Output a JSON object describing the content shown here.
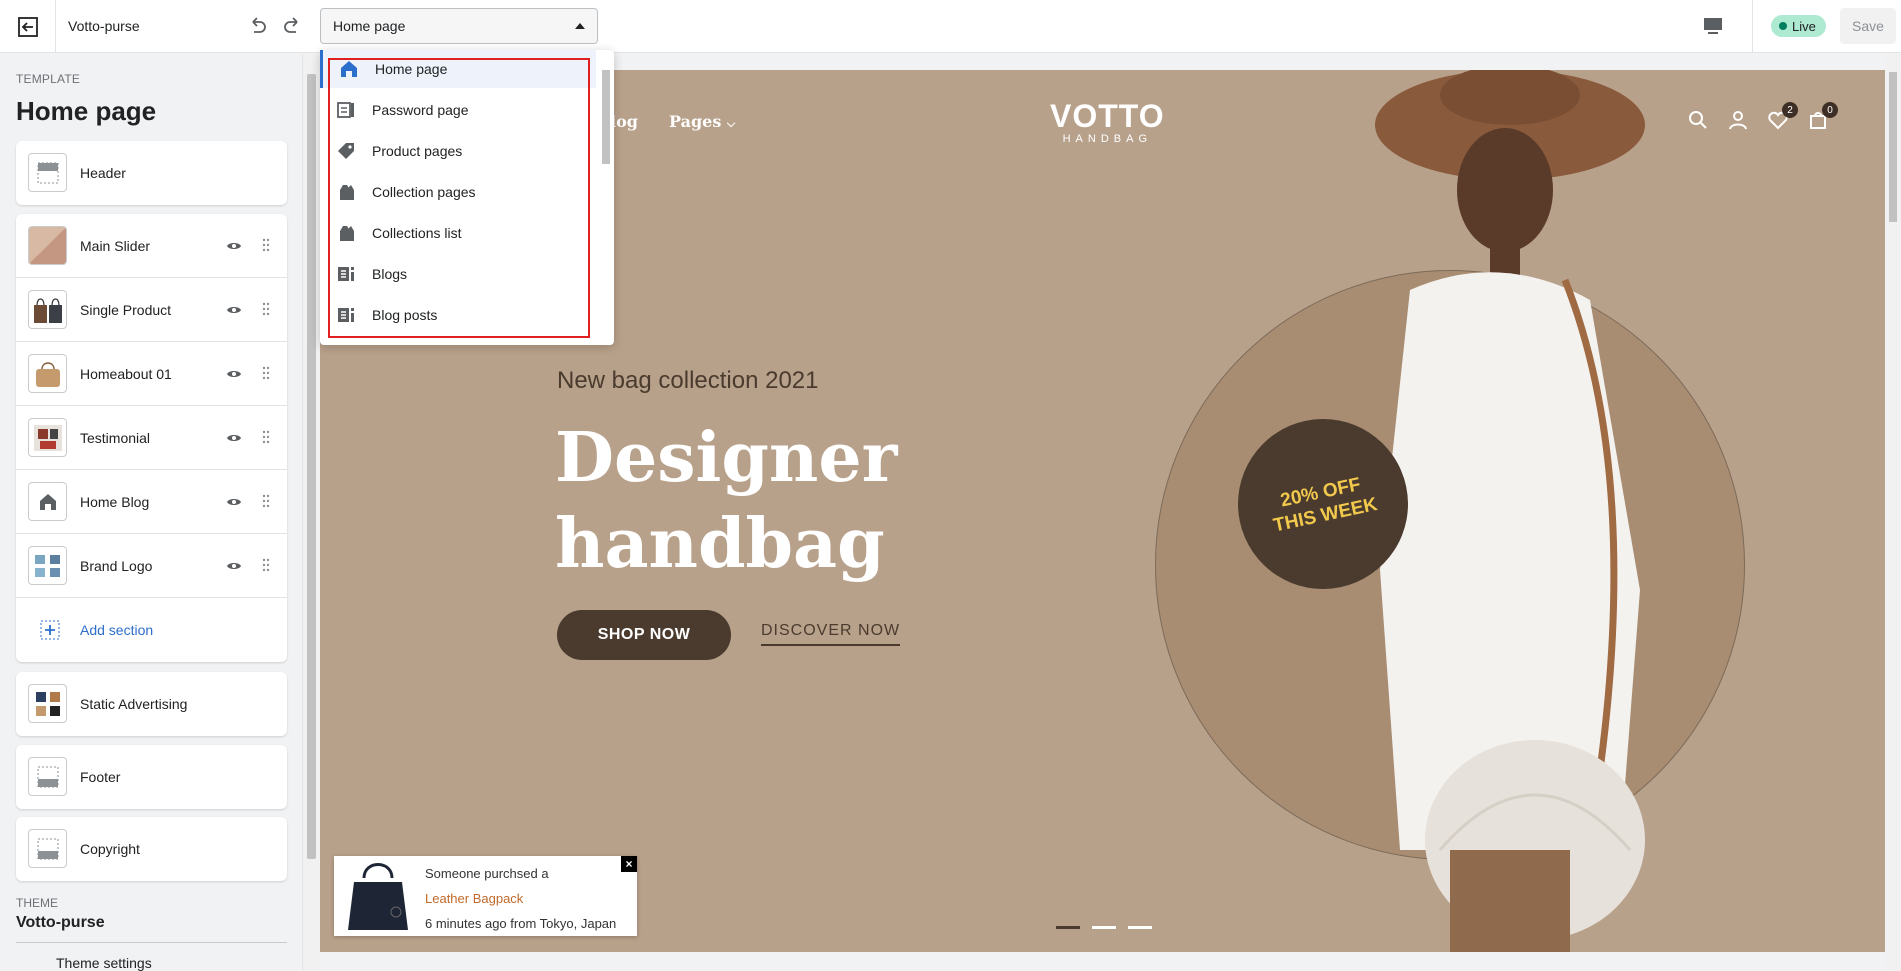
{
  "topbar": {
    "store_name": "Votto-purse",
    "template_selector": "Home page",
    "live_label": "Live",
    "save_label": "Save"
  },
  "sidebar": {
    "template_caption": "TEMPLATE",
    "template_title": "Home page",
    "header_item": "Header",
    "sections": [
      {
        "label": "Main Slider"
      },
      {
        "label": "Single Product"
      },
      {
        "label": "Homeabout 01"
      },
      {
        "label": "Testimonial"
      },
      {
        "label": "Home Blog"
      },
      {
        "label": "Brand Logo"
      }
    ],
    "add_section": "Add section",
    "static_advertising": "Static Advertising",
    "footer": "Footer",
    "copyright": "Copyright",
    "theme_caption": "THEME",
    "theme_name": "Votto-purse",
    "theme_settings": "Theme settings"
  },
  "dropdown": {
    "items": [
      {
        "label": "Home page",
        "icon": "home-icon"
      },
      {
        "label": "Password page",
        "icon": "password-icon"
      },
      {
        "label": "Product pages",
        "icon": "tag-icon"
      },
      {
        "label": "Collection pages",
        "icon": "collection-icon"
      },
      {
        "label": "Collections list",
        "icon": "collection-icon"
      },
      {
        "label": "Blogs",
        "icon": "blog-icon"
      },
      {
        "label": "Blog posts",
        "icon": "blog-icon"
      }
    ],
    "selected": "Home page"
  },
  "preview": {
    "nav_blog": "log",
    "nav_pages": "Pages",
    "logo_main": "VOTTO",
    "logo_sub": "HANDBAG",
    "wishlist_count": "2",
    "cart_count": "0",
    "hero_subtitle": "New bag collection 2021",
    "hero_title": "Designer handbag",
    "shop_now": "SHOP NOW",
    "discover_now": "DISCOVER NOW",
    "badge_line1": "20% OFF",
    "badge_line2": "THIS WEEK",
    "colors": {
      "background": "#b8a18a",
      "dark": "#4a3b2e",
      "badge_text": "#f2c94c"
    }
  },
  "popup": {
    "line1": "Someone purchsed a",
    "product": "Leather Bagpack",
    "line3": "6 minutes ago from Tokyo, Japan"
  }
}
